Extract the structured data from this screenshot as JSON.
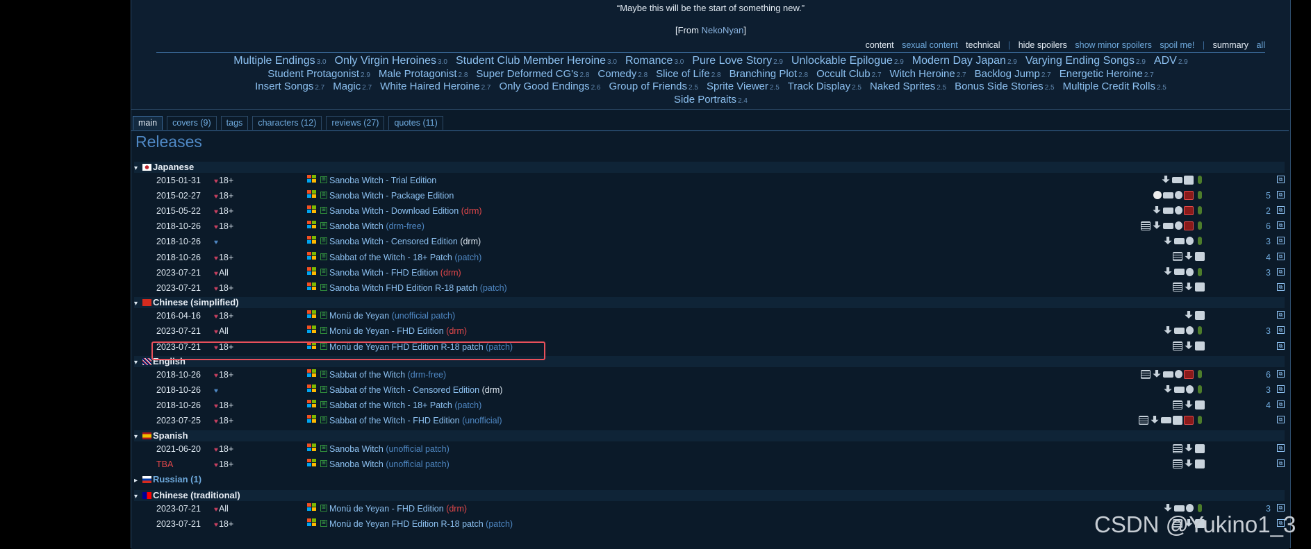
{
  "quote": {
    "text": "“Maybe this will be the start of something new.”",
    "from_prefix": "[From",
    "from_name": "NekoNyan",
    "from_suffix": "]"
  },
  "filters": {
    "content": "content",
    "sexual_content": "sexual content",
    "technical": "technical",
    "sep": "|",
    "hide_spoilers": "hide spoilers",
    "show_minor_spoilers": "show minor spoilers",
    "spoil_me": "spoil me!",
    "summary": "summary",
    "all": "all"
  },
  "tag_lines": [
    [
      {
        "name": "Multiple Endings",
        "score": "3.0"
      },
      {
        "name": "Only Virgin Heroines",
        "score": "3.0"
      },
      {
        "name": "Student Club Member Heroine",
        "score": "3.0"
      },
      {
        "name": "Romance",
        "score": "3.0"
      },
      {
        "name": "Pure Love Story",
        "score": "2.9"
      },
      {
        "name": "Unlockable Epilogue",
        "score": "2.9"
      },
      {
        "name": "Modern Day Japan",
        "score": "2.9"
      },
      {
        "name": "Varying Ending Songs",
        "score": "2.9"
      },
      {
        "name": "ADV",
        "score": "2.9"
      }
    ],
    [
      {
        "name": "Student Protagonist",
        "score": "2.9"
      },
      {
        "name": "Male Protagonist",
        "score": "2.8"
      },
      {
        "name": "Super Deformed CG's",
        "score": "2.8"
      },
      {
        "name": "Comedy",
        "score": "2.8"
      },
      {
        "name": "Slice of Life",
        "score": "2.8"
      },
      {
        "name": "Branching Plot",
        "score": "2.8"
      },
      {
        "name": "Occult Club",
        "score": "2.7"
      },
      {
        "name": "Witch Heroine",
        "score": "2.7"
      },
      {
        "name": "Backlog Jump",
        "score": "2.7"
      },
      {
        "name": "Energetic Heroine",
        "score": "2.7"
      }
    ],
    [
      {
        "name": "Insert Songs",
        "score": "2.7"
      },
      {
        "name": "Magic",
        "score": "2.7"
      },
      {
        "name": "White Haired Heroine",
        "score": "2.7"
      },
      {
        "name": "Only Good Endings",
        "score": "2.6"
      },
      {
        "name": "Group of Friends",
        "score": "2.5"
      },
      {
        "name": "Sprite Viewer",
        "score": "2.5"
      },
      {
        "name": "Track Display",
        "score": "2.5"
      },
      {
        "name": "Naked Sprites",
        "score": "2.5"
      },
      {
        "name": "Bonus Side Stories",
        "score": "2.5"
      },
      {
        "name": "Multiple Credit Rolls",
        "score": "2.5"
      }
    ],
    [
      {
        "name": "Side Portraits",
        "score": "2.4"
      }
    ]
  ],
  "tabs": [
    "main",
    "covers (9)",
    "tags",
    "characters (12)",
    "reviews (27)",
    "quotes (11)"
  ],
  "releases_title": "Releases",
  "languages": [
    {
      "name": "Japanese",
      "flag": "jp",
      "collapsed": false,
      "releases": [
        {
          "date": "2015-01-31",
          "age": "18+",
          "title": "Sanoba Witch - Trial Edition",
          "note": "",
          "note_type": "",
          "icons": [
            "dl",
            "nc",
            "gift",
            "mic"
          ],
          "count": ""
        },
        {
          "date": "2015-02-27",
          "age": "18+",
          "title": "Sanoba Witch - Package Edition",
          "note": "",
          "note_type": "",
          "icons": [
            "disc",
            "nc",
            "money",
            "vn",
            "mic"
          ],
          "count": "5"
        },
        {
          "date": "2015-05-22",
          "age": "18+",
          "title": "Sanoba Witch - Download Edition",
          "note": "(drm)",
          "note_type": "drm",
          "icons": [
            "dl",
            "nc",
            "money",
            "vn",
            "mic"
          ],
          "count": "2"
        },
        {
          "date": "2018-10-26",
          "age": "18+",
          "title": "Sanoba Witch",
          "note": "(drm-free)",
          "note_type": "note",
          "icons": [
            "doc",
            "dl",
            "nc",
            "money",
            "vn",
            "mic"
          ],
          "count": "6"
        },
        {
          "date": "2018-10-26",
          "age": "",
          "title": "Sanoba Witch - Censored Edition",
          "note": "(drm)",
          "note_type": "drmw",
          "icons": [
            "dl",
            "nc",
            "money",
            "mic"
          ],
          "count": "3"
        },
        {
          "date": "2018-10-26",
          "age": "18+",
          "title": "Sabbat of the Witch - 18+ Patch",
          "note": "(patch)",
          "note_type": "note",
          "icons": [
            "doc",
            "dl",
            "gift"
          ],
          "count": "4"
        },
        {
          "date": "2023-07-21",
          "age": "All",
          "title": "Sanoba Witch - FHD Edition",
          "note": "(drm)",
          "note_type": "drm",
          "icons": [
            "dl",
            "nc",
            "money",
            "mic"
          ],
          "count": "3"
        },
        {
          "date": "2023-07-21",
          "age": "18+",
          "title": "Sanoba Witch FHD Edition R-18 patch",
          "note": "(patch)",
          "note_type": "note",
          "icons": [
            "doc",
            "dl",
            "gift"
          ],
          "count": ""
        }
      ]
    },
    {
      "name": "Chinese (simplified)",
      "flag": "cn",
      "collapsed": false,
      "releases": [
        {
          "date": "2016-04-16",
          "age": "18+",
          "title": "Monü de Yeyan",
          "note": "(unofficial patch)",
          "note_type": "note",
          "icons": [
            "dl",
            "gift"
          ],
          "count": ""
        },
        {
          "date": "2023-07-21",
          "age": "All",
          "title": "Monü de Yeyan - FHD Edition",
          "note": "(drm)",
          "note_type": "drm",
          "icons": [
            "dl",
            "nc",
            "money",
            "mic"
          ],
          "count": "3"
        },
        {
          "date": "2023-07-21",
          "age": "18+",
          "title": "Monü de Yeyan FHD Edition R-18 patch",
          "note": "(patch)",
          "note_type": "note",
          "icons": [
            "doc",
            "dl",
            "gift"
          ],
          "count": ""
        }
      ]
    },
    {
      "name": "English",
      "flag": "gb",
      "collapsed": false,
      "releases": [
        {
          "date": "2018-10-26",
          "age": "18+",
          "title": "Sabbat of the Witch",
          "note": "(drm-free)",
          "note_type": "note",
          "icons": [
            "doc",
            "dl",
            "nc",
            "money",
            "vn",
            "mic"
          ],
          "count": "6"
        },
        {
          "date": "2018-10-26",
          "age": "",
          "title": "Sabbat of the Witch - Censored Edition",
          "note": "(drm)",
          "note_type": "drmw",
          "icons": [
            "dl",
            "nc",
            "money",
            "mic"
          ],
          "count": "3"
        },
        {
          "date": "2018-10-26",
          "age": "18+",
          "title": "Sabbat of the Witch - 18+ Patch",
          "note": "(patch)",
          "note_type": "note",
          "icons": [
            "doc",
            "dl",
            "gift"
          ],
          "count": "4"
        },
        {
          "date": "2023-07-25",
          "age": "18+",
          "title": "Sabbat of the Witch - FHD Edition",
          "note": "(unofficial)",
          "note_type": "note",
          "icons": [
            "doc",
            "dl",
            "nc",
            "gift",
            "vn",
            "mic"
          ],
          "count": ""
        }
      ]
    },
    {
      "name": "Spanish",
      "flag": "es",
      "collapsed": false,
      "releases": [
        {
          "date": "2021-06-20",
          "age": "18+",
          "title": "Sanoba Witch",
          "note": "(unofficial patch)",
          "note_type": "note",
          "icons": [
            "doc",
            "dl",
            "gift"
          ],
          "count": ""
        },
        {
          "date": "TBA",
          "age": "18+",
          "title": "Sanoba Witch",
          "note": "(unofficial patch)",
          "note_type": "note",
          "icons": [
            "doc",
            "dl",
            "gift"
          ],
          "count": ""
        }
      ]
    },
    {
      "name": "Russian (1)",
      "flag": "ru",
      "collapsed": true,
      "releases": []
    },
    {
      "name": "Chinese (traditional)",
      "flag": "tw",
      "collapsed": false,
      "releases": [
        {
          "date": "2023-07-21",
          "age": "All",
          "title": "Monü de Yeyan - FHD Edition",
          "note": "(drm)",
          "note_type": "drm",
          "icons": [
            "dl",
            "nc",
            "money",
            "mic"
          ],
          "count": "3"
        },
        {
          "date": "2023-07-21",
          "age": "18+",
          "title": "Monü de Yeyan FHD Edition R-18 patch",
          "note": "(patch)",
          "note_type": "note",
          "icons": [
            "doc",
            "dl",
            "gift"
          ],
          "count": ""
        }
      ]
    }
  ],
  "watermark": "CSDN @Yukino1_3",
  "colors": {
    "accent": "#8cc0f0",
    "drm": "#e2474a",
    "highlight": "#e8505b",
    "background": "#0b1a29"
  }
}
